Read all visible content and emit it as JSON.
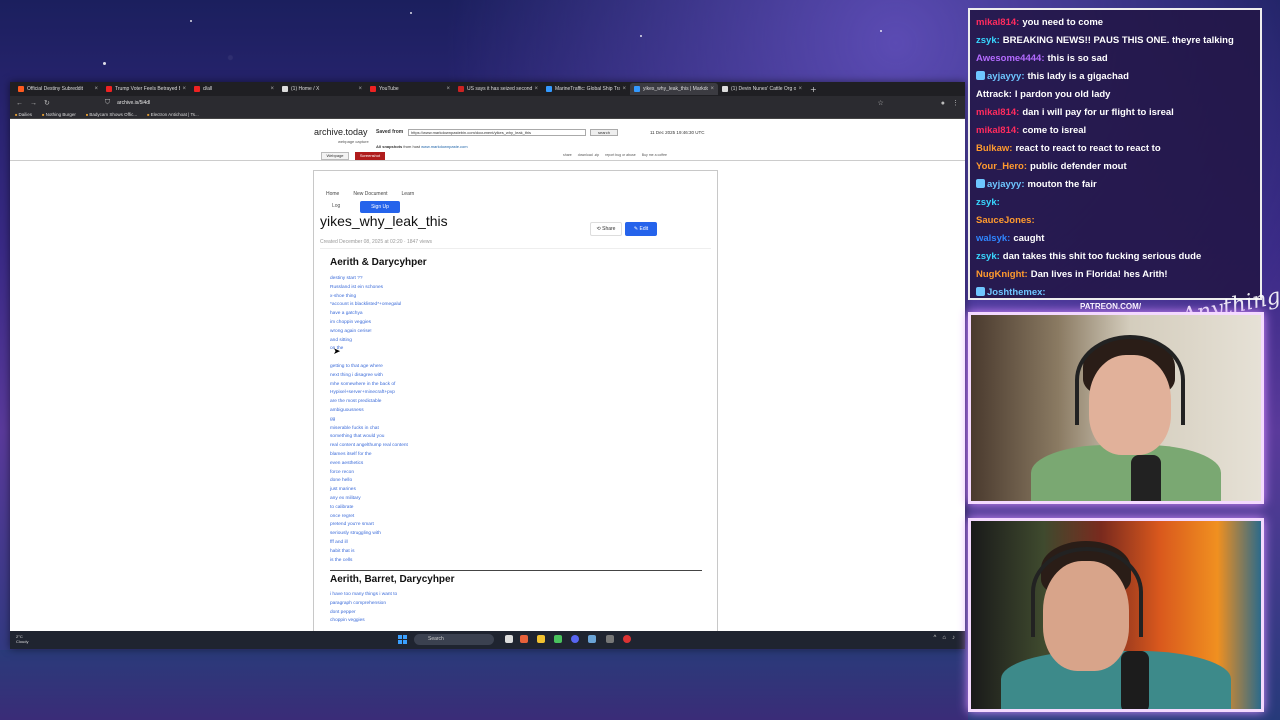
{
  "browser": {
    "tabs": [
      {
        "label": "Official Destiny Subreddit",
        "color": "#ff5a1f"
      },
      {
        "label": "Trump Voter Feels Betrayed By...",
        "color": "#e22"
      },
      {
        "label": "d/all",
        "color": "#e22"
      },
      {
        "label": "(1) Home / X",
        "color": "#ddd"
      },
      {
        "label": "YouTube",
        "color": "#e22"
      },
      {
        "label": "US says it has seized second ta...",
        "color": "#c22"
      },
      {
        "label": "MarineTraffic: Global Ship Track...",
        "color": "#39f"
      },
      {
        "label": "yikes_why_leak_this | Markdow...",
        "color": "#39f",
        "active": true
      },
      {
        "label": "(1) Devin Nunes' Cattle Org on...",
        "color": "#ddd"
      }
    ],
    "url": "archive.is/5i4dl",
    "bookmarks": [
      "Dailies",
      "Nothing Burger",
      "Badycam Shows Offic...",
      "Electron Antichoat | Ts..."
    ]
  },
  "archive": {
    "logo": "archive.today",
    "sub": "webpage capture",
    "saved_from_label": "Saved from",
    "saved_url": "https://www.markdownpastebin.com/document/yikes_why_leak_this",
    "search_label": "search",
    "date": "11 Dec 2025 19:46:30 UTC",
    "all_snapshots_label": "All snapshots",
    "from_host_label": "from host",
    "snap_host": "www.markdownpaste.com",
    "tab_webpage": "Webpage",
    "tab_screenshot": "Screenshot",
    "links": [
      "share",
      "download .zip",
      "report bug or abuse",
      "Buy me a coffee"
    ]
  },
  "doc": {
    "nav": [
      "Home",
      "New Document",
      "Learn"
    ],
    "login": "Log",
    "signup": "Sign Up",
    "title": "yikes_why_leak_this",
    "share": "Share",
    "edit": "Edit",
    "meta": "Created December 08, 2025 at 02:20  ·  1847 views",
    "section1_title": "Aerith & Darycyhper",
    "section1_lines": [
      "destiny start ??",
      "Russland ist ein schones",
      "x-shoe thing",
      "*account is blacklisted*+omegalul",
      "have a gatchya",
      "im choppin veggies",
      "wrong again cerise!",
      "and sitting",
      "on the",
      "",
      "getting to that age where",
      "next thing i disagree with",
      "mhe somewhere in the back of",
      "Hypixel+server+minecraft+pvp",
      "are the most predictable",
      "ambiguousness",
      "gg",
      "miserable fucks in chat",
      "something that would you",
      "real content angelthump real content",
      "blames itself for the",
      "even aesthetics",
      "force recon",
      "done hello",
      "just marines",
      "any ex military",
      "to calibrate",
      "once regret",
      "pretend you're smart",
      "seriously struggling with",
      "fff and ill",
      "habit that is",
      "is the cells"
    ],
    "section2_title": "Aerith, Barret, Darycyhper",
    "section2_lines": [
      "i have too many things i want to",
      "paragraph comprehension",
      "dont pepper",
      "choppin veggies"
    ]
  },
  "taskbar": {
    "weather_temp": "2°C",
    "weather_desc": "Cloudy",
    "search": "Search"
  },
  "chat": [
    {
      "user": "mikal814:",
      "color": "#ff2b5e",
      "text": "you need to come"
    },
    {
      "user": "zsyk:",
      "color": "#38d7ff",
      "text": "BREAKING NEWS!! PAUS THIS ONE. theyre talking"
    },
    {
      "user": "Awesome4444:",
      "color": "#b46bff",
      "text": "this is so sad"
    },
    {
      "user": "ayjayyy:",
      "color": "#6ec6ff",
      "text": "this lady is a gigachad",
      "badge": true
    },
    {
      "user": "Attrack:",
      "color": "#ffffff",
      "text": "I pardon you old lady"
    },
    {
      "user": "mikal814:",
      "color": "#ff2b5e",
      "text": "dan i will pay for ur flight to isreal"
    },
    {
      "user": "mikal814:",
      "color": "#ff2b5e",
      "text": "come to isreal"
    },
    {
      "user": "Bulkaw:",
      "color": "#ff9a2e",
      "text": "react to react to react to react to"
    },
    {
      "user": "Your_Hero:",
      "color": "#ff9a2e",
      "text": "public defender mout"
    },
    {
      "user": "ayjayyy:",
      "color": "#6ec6ff",
      "text": "mouton the fair",
      "badge": true
    },
    {
      "user": "zsyk:",
      "color": "#38d7ff",
      "text": ""
    },
    {
      "user": "SauceJones:",
      "color": "#ff9a2e",
      "text": ""
    },
    {
      "user": "walsyk:",
      "color": "#2f86ff",
      "text": "caught"
    },
    {
      "user": "zsyk:",
      "color": "#38d7ff",
      "text": "dan takes this shit too fucking serious dude"
    },
    {
      "user": "NugKnight:",
      "color": "#ff9a2e",
      "text": "Dan lives in Florida! hes Arith!"
    },
    {
      "user": "Joshthemex:",
      "color": "#6ec6ff",
      "text": "",
      "badge": true
    }
  ],
  "overlay": {
    "patreon": "PATREON.COM/",
    "signature": "AnythingElse?"
  }
}
